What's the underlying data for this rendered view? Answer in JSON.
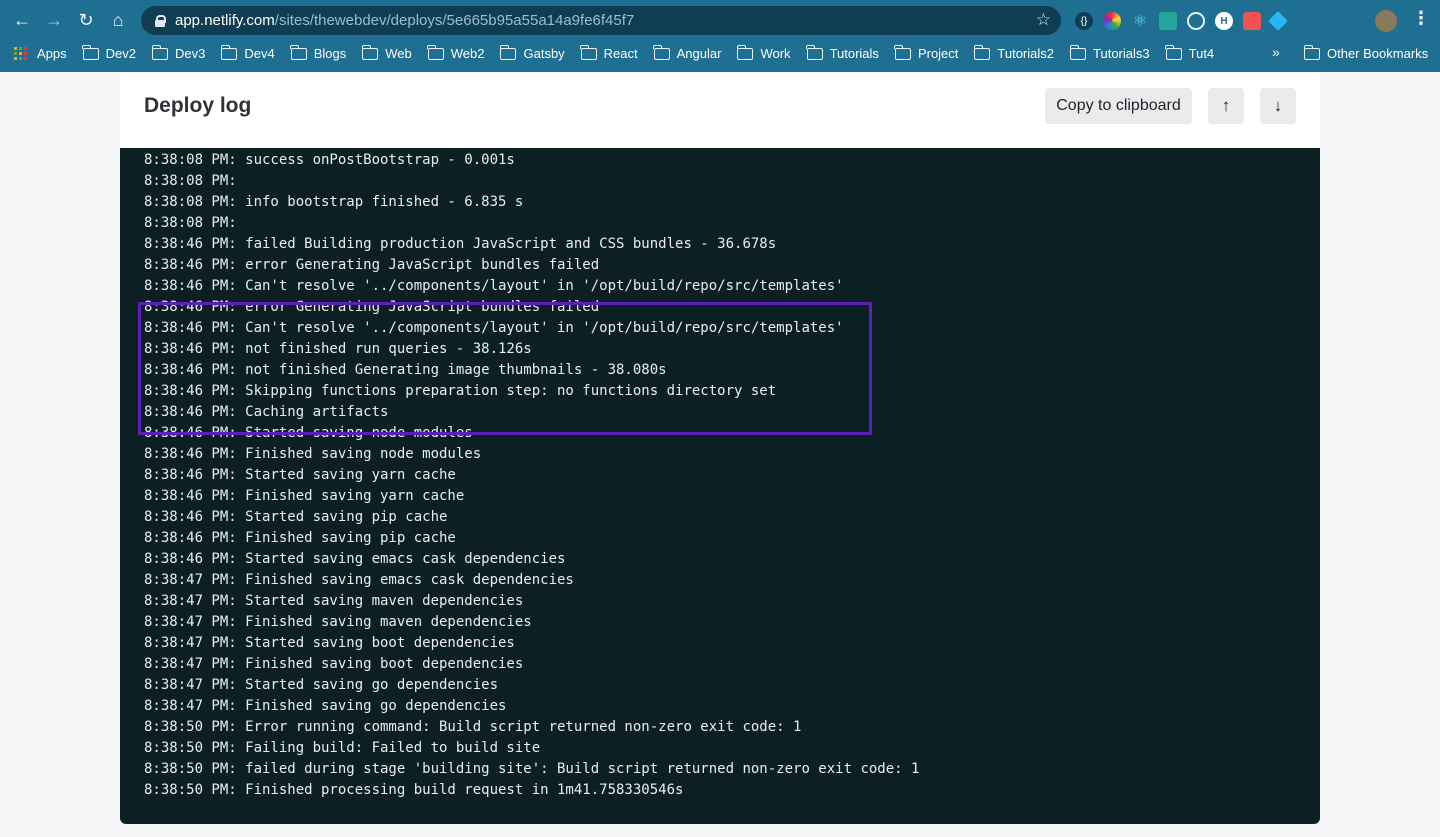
{
  "browser": {
    "url_host": "app.netlify.com",
    "url_path": "/sites/thewebdev/deploys/5e665b95a55a14a9fe6f45f7",
    "bookmarks": [
      "Apps",
      "Dev2",
      "Dev3",
      "Dev4",
      "Blogs",
      "Web",
      "Web2",
      "Gatsby",
      "React",
      "Angular",
      "Work",
      "Tutorials",
      "Project",
      "Tutorials2",
      "Tutorials3",
      "Tut4"
    ],
    "more": "»",
    "other_bookmarks": "Other Bookmarks"
  },
  "page": {
    "title": "Deploy log",
    "copy_button": "Copy to clipboard",
    "scroll_up": "↑",
    "scroll_down": "↓"
  },
  "log": {
    "lines": [
      "8:38:08 PM: success onPostBootstrap - 0.001s",
      "8:38:08 PM:",
      "8:38:08 PM: info bootstrap finished - 6.835 s",
      "8:38:08 PM:",
      "8:38:46 PM: failed Building production JavaScript and CSS bundles - 36.678s",
      "8:38:46 PM: error Generating JavaScript bundles failed",
      "8:38:46 PM: Can't resolve '../components/layout' in '/opt/build/repo/src/templates'",
      "8:38:46 PM: error Generating JavaScript bundles failed",
      "8:38:46 PM: Can't resolve '../components/layout' in '/opt/build/repo/src/templates'",
      "8:38:46 PM: not finished run queries - 38.126s",
      "8:38:46 PM: not finished Generating image thumbnails - 38.080s",
      "8:38:46 PM: Skipping functions preparation step: no functions directory set",
      "8:38:46 PM: Caching artifacts",
      "8:38:46 PM: Started saving node modules",
      "8:38:46 PM: Finished saving node modules",
      "8:38:46 PM: Started saving yarn cache",
      "8:38:46 PM: Finished saving yarn cache",
      "8:38:46 PM: Started saving pip cache",
      "8:38:46 PM: Finished saving pip cache",
      "8:38:46 PM: Started saving emacs cask dependencies",
      "8:38:47 PM: Finished saving emacs cask dependencies",
      "8:38:47 PM: Started saving maven dependencies",
      "8:38:47 PM: Finished saving maven dependencies",
      "8:38:47 PM: Started saving boot dependencies",
      "8:38:47 PM: Finished saving boot dependencies",
      "8:38:47 PM: Started saving go dependencies",
      "8:38:47 PM: Finished saving go dependencies",
      "8:38:50 PM: Error running command: Build script returned non-zero exit code: 1",
      "8:38:50 PM: Failing build: Failed to build site",
      "8:38:50 PM: failed during stage 'building site': Build script returned non-zero exit code: 1",
      "8:38:50 PM: Finished processing build request in 1m41.758330546s"
    ]
  },
  "colors": {
    "chrome_bar": "#1f6f93",
    "log_background": "#0c1f23",
    "log_text": "#e9eef0",
    "highlight_border": "#5b21b6"
  },
  "icons": [
    "back-icon",
    "forward-icon",
    "reload-icon",
    "home-icon",
    "lock-icon",
    "star-icon",
    "folder-icon",
    "apps-grid-icon",
    "arrow-up-icon",
    "arrow-down-icon"
  ]
}
